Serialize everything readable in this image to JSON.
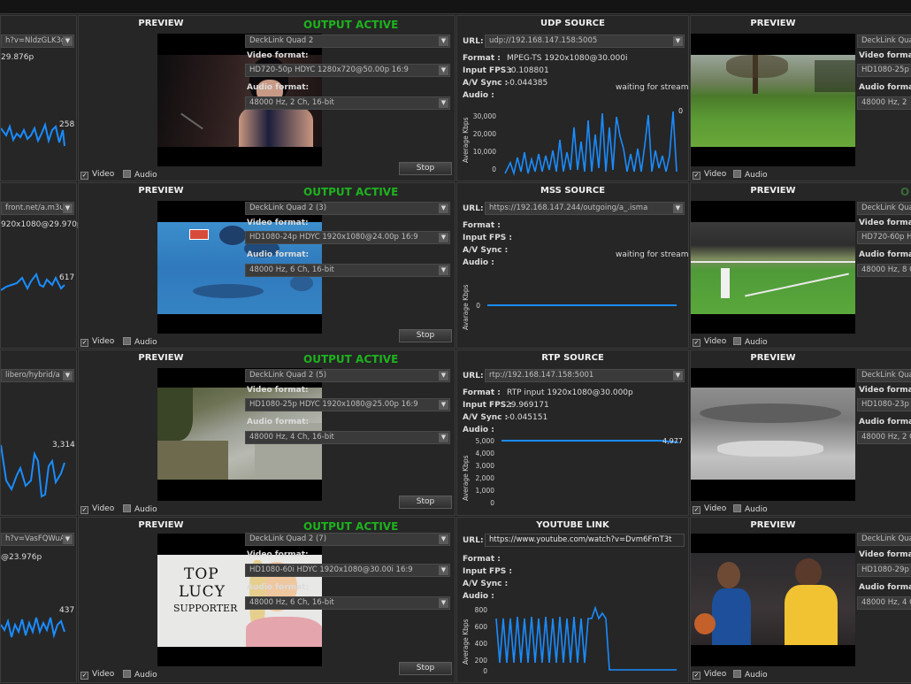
{
  "rows": [
    {
      "left": {
        "url_partial": "h?v=NldzGLK3gt",
        "format_partial": "29.876p",
        "graph_value": "258"
      },
      "center": {
        "header": "PREVIEW",
        "status": "OUTPUT ACTIVE",
        "device": "DeckLink Quad 2",
        "video_format_label": "Video format:",
        "video_format": "HD720-50p HDYC 1280x720@50.00p 16:9",
        "audio_format_label": "Audio format:",
        "audio_format": "48000 Hz, 2 Ch, 16-bit",
        "stop": "Stop",
        "video_chk": "Video",
        "audio_chk": "Audio"
      },
      "source": {
        "header": "UDP SOURCE",
        "url_label": "URL:",
        "url": "udp://192.168.147.158:5005",
        "format_label": "Format :",
        "format": "MPEG-TS 1920x1080@30.000i",
        "fps_label": "Input FPS :",
        "fps": "30.108801",
        "sync_label": "A/V Sync :",
        "sync": "-0.044385",
        "audio_label": "Audio :",
        "message": "waiting for stream",
        "y_axis_label": "Average Kbps",
        "ticks": [
          "30,000",
          "20,000",
          "10,000",
          "0"
        ],
        "value_label": "0"
      },
      "right": {
        "header": "PREVIEW",
        "device": "DeckLink Quad",
        "video_format_label": "Video format:",
        "video_format": "HD1080-25p",
        "audio_format_label": "Audio format:",
        "audio_format": "48000 Hz, 2",
        "video_chk": "Video",
        "audio_chk": "Audio"
      }
    },
    {
      "left": {
        "url_partial": "front.net/a.m3u8",
        "format_partial": "920x1080@29.970p",
        "graph_value": "617"
      },
      "center": {
        "header": "PREVIEW",
        "status": "OUTPUT ACTIVE",
        "device": "DeckLink Quad 2 (3)",
        "video_format_label": "Video format:",
        "video_format": "HD1080-24p HDYC 1920x1080@24.00p 16:9",
        "audio_format_label": "Audio format:",
        "audio_format": "48000 Hz, 6 Ch, 16-bit",
        "stop": "Stop",
        "video_chk": "Video",
        "audio_chk": "Audio"
      },
      "source": {
        "header": "MSS SOURCE",
        "url_label": "URL:",
        "url": "https://192.168.147.244/outgoing/a_.isma",
        "format_label": "Format :",
        "format": "",
        "fps_label": "Input FPS :",
        "fps": "",
        "sync_label": "A/V Sync :",
        "sync": "",
        "audio_label": "Audio :",
        "message": "waiting for stream",
        "y_axis_label": "Avarage Kbps",
        "ticks": [
          "0"
        ],
        "value_label": ""
      },
      "right": {
        "header": "PREVIEW",
        "status_partial": "O",
        "device": "DeckLink Quad",
        "video_format_label": "Video format:",
        "video_format": "HD720-60p H",
        "audio_format_label": "Audio format:",
        "audio_format": "48000 Hz, 8 C",
        "video_chk": "Video",
        "audio_chk": "Audio"
      }
    },
    {
      "left": {
        "url_partial": "libero/hybrid/a",
        "format_partial": "",
        "graph_value": "3,314"
      },
      "center": {
        "header": "PREVIEW",
        "status": "OUTPUT ACTIVE",
        "device": "DeckLink Quad 2 (5)",
        "video_format_label": "Video format:",
        "video_format": "HD1080-25p HDYC 1920x1080@25.00p 16:9",
        "audio_format_label": "Audio format:",
        "audio_format": "48000 Hz, 4 Ch, 16-bit",
        "stop": "Stop",
        "video_chk": "Video",
        "audio_chk": "Audio"
      },
      "source": {
        "header": "RTP SOURCE",
        "url_label": "URL:",
        "url": "rtp://192.168.147.158:5001",
        "format_label": "Format :",
        "format": "RTP input 1920x1080@30.000p",
        "fps_label": "Input FPS :",
        "fps": "29.969171",
        "sync_label": "A/V Sync :",
        "sync": "-0.045151",
        "audio_label": "Audio :",
        "message": "",
        "y_axis_label": "Average Kbps",
        "ticks": [
          "5,000",
          "4,000",
          "3,000",
          "2,000",
          "1,000",
          "0"
        ],
        "value_label": "4,977"
      },
      "right": {
        "header": "PREVIEW",
        "device": "DeckLink Quad",
        "video_format_label": "Video format:",
        "video_format": "HD1080-23p",
        "audio_format_label": "Audio format:",
        "audio_format": "48000 Hz, 2 C",
        "video_chk": "Video",
        "audio_chk": "Audio"
      }
    },
    {
      "left": {
        "url_partial": "h?v=VasFQWuA",
        "format_partial": "@23.976p",
        "graph_value": "437"
      },
      "center": {
        "header": "PREVIEW",
        "status": "OUTPUT ACTIVE",
        "device": "DeckLink Quad 2 (7)",
        "video_format_label": "Video format:",
        "video_format": "HD1080-60i HDYC 1920x1080@30.00i 16:9",
        "audio_format_label": "Audio format:",
        "audio_format": "48000 Hz, 6 Ch, 16-bit",
        "stop": "Stop",
        "video_chk": "Video",
        "audio_chk": "Audio",
        "thumb_text": [
          "TOP",
          "LUCY",
          "SUPPORTER"
        ]
      },
      "source": {
        "header": "YOUTUBE LINK",
        "url_label": "URL:",
        "url": "https://www.youtube.com/watch?v=Dvm6FmT3t",
        "format_label": "Format :",
        "format": "",
        "fps_label": "Input FPS :",
        "fps": "",
        "sync_label": "A/V Sync :",
        "sync": "",
        "audio_label": "Audio :",
        "message": "",
        "y_axis_label": "Average Kbps",
        "ticks": [
          "800",
          "600",
          "400",
          "200",
          "0"
        ],
        "value_label": ""
      },
      "right": {
        "header": "PREVIEW",
        "device": "DeckLink Quad",
        "video_format_label": "Video format:",
        "video_format": "HD1080-29p",
        "audio_format_label": "Audio format:",
        "audio_format": "48000 Hz, 4 C",
        "video_chk": "Video",
        "audio_chk": "Audio"
      }
    }
  ]
}
